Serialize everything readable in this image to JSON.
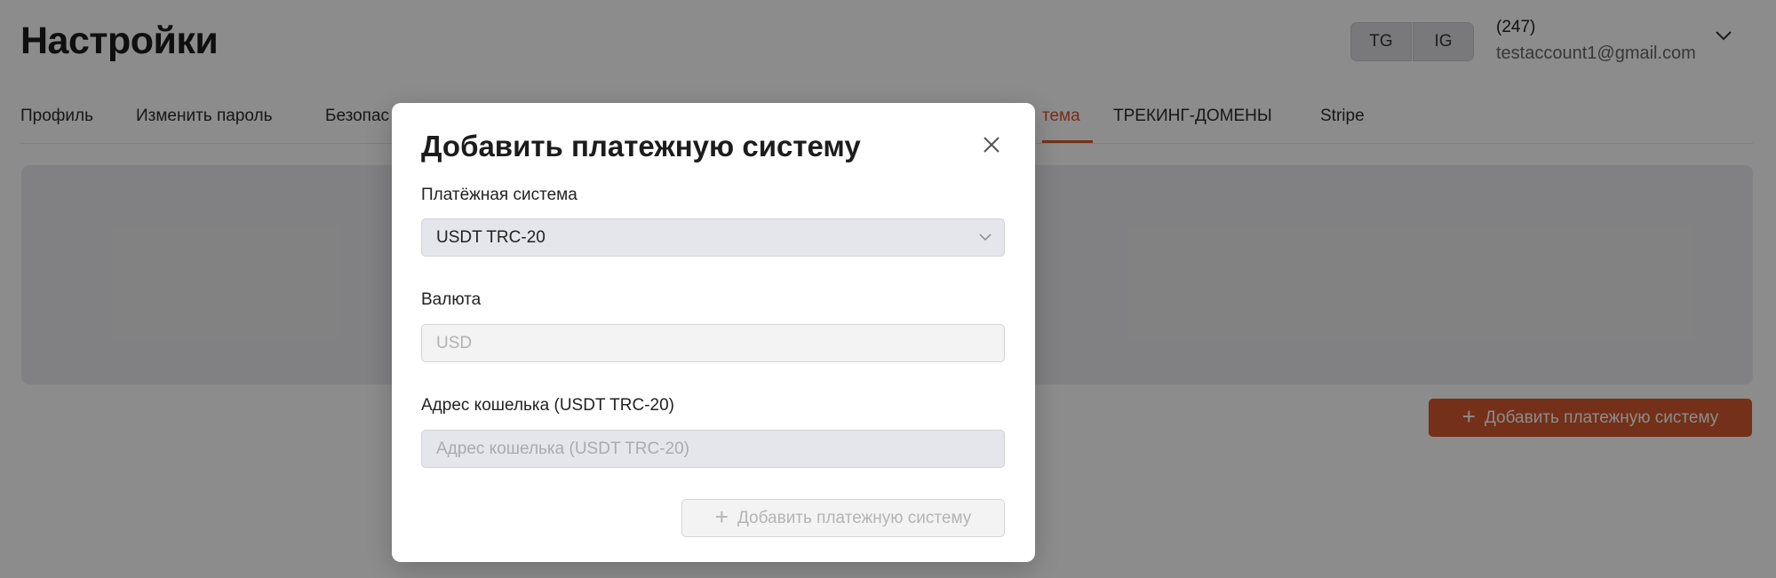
{
  "header": {
    "title": "Настройки",
    "social_buttons": [
      "TG",
      "IG"
    ],
    "account": {
      "count": "(247)",
      "email": "testaccount1@gmail.com"
    }
  },
  "tabs": [
    {
      "label": "Профиль"
    },
    {
      "label": "Изменить пароль"
    },
    {
      "label": "Безопас"
    },
    {
      "label": "тема",
      "active": true
    },
    {
      "label": "ТРЕКИНГ-ДОМЕНЫ"
    },
    {
      "label": "Stripe"
    }
  ],
  "page": {
    "add_button_label": "Добавить платежную систему",
    "add_icon": "plus-icon"
  },
  "modal": {
    "title": "Добавить платежную систему",
    "close_icon": "close-icon",
    "payment_system": {
      "label": "Платёжная система",
      "value": "USDT TRC-20"
    },
    "currency": {
      "label": "Валюта",
      "placeholder": "USD"
    },
    "wallet": {
      "label": "Адрес кошелька (USDT TRC-20)",
      "placeholder": "Адрес кошелька (USDT TRC-20)"
    },
    "submit_label": "Добавить платежную систему"
  },
  "colors": {
    "accent": "#d4582d",
    "overlay": "rgba(0,0,0,0.45)"
  }
}
